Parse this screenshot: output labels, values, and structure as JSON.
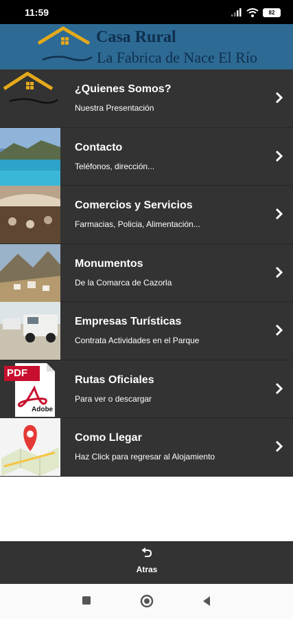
{
  "status_bar": {
    "time": "11:59",
    "battery": "82"
  },
  "header": {
    "title_line1": "Casa Rural",
    "title_line2": "La Fabrica de Nace El Río"
  },
  "menu": {
    "items": [
      {
        "title": "¿Quienes Somos?",
        "subtitle": "Nuestra Presentación"
      },
      {
        "title": "Contacto",
        "subtitle": "Teléfonos, dirección..."
      },
      {
        "title": "Comercios y Servicios",
        "subtitle": "Farmacias, Policia, Alimentación..."
      },
      {
        "title": "Monumentos",
        "subtitle": "De la Comarca de Cazorla"
      },
      {
        "title": "Empresas Turísticas",
        "subtitle": "Contrata Actividades en el Parque"
      },
      {
        "title": "Rutas Oficiales",
        "subtitle": "Para ver o descargar"
      },
      {
        "title": "Como Llegar",
        "subtitle": "Haz Click para regresar al Alojamiento"
      }
    ]
  },
  "pdf_thumb": {
    "badge": "PDF",
    "brand": "Adobe"
  },
  "bottom_bar": {
    "back_label": "Atras"
  },
  "colors": {
    "banner": "#2d6a94",
    "list_bg": "#333333",
    "logo_roof": "#e5a91b"
  },
  "icons": [
    "signal-icon",
    "wifi-icon",
    "battery-icon",
    "chevron-right-icon",
    "undo-icon",
    "nav-recents-icon",
    "nav-home-icon",
    "nav-back-icon"
  ]
}
